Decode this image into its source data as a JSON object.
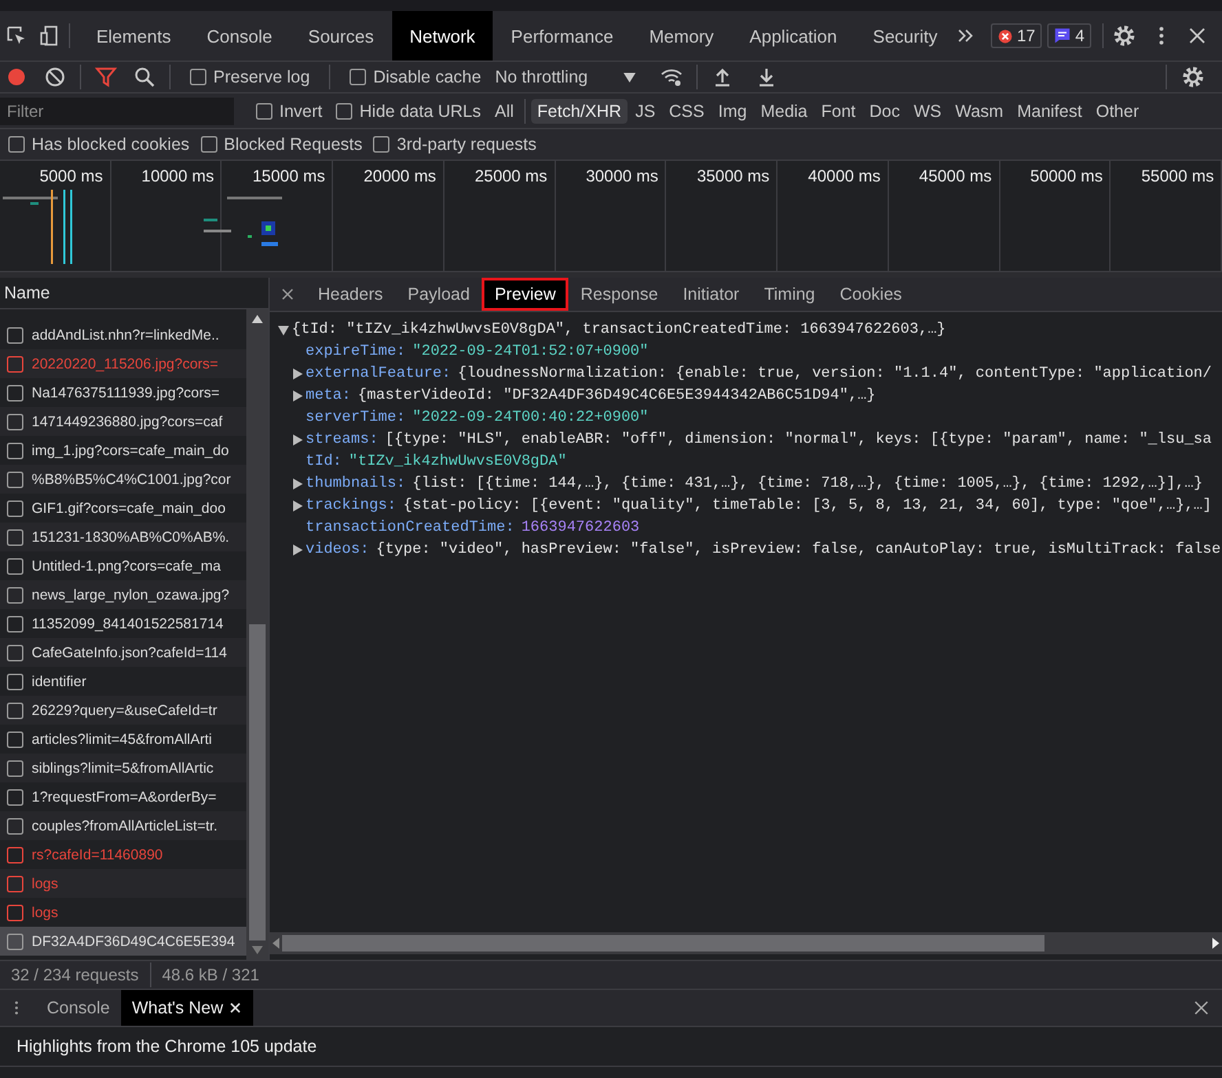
{
  "main_tabs": [
    {
      "label": "Elements",
      "selected": false
    },
    {
      "label": "Console",
      "selected": false
    },
    {
      "label": "Sources",
      "selected": false
    },
    {
      "label": "Network",
      "selected": true
    },
    {
      "label": "Performance",
      "selected": false
    },
    {
      "label": "Memory",
      "selected": false
    },
    {
      "label": "Application",
      "selected": false
    },
    {
      "label": "Security",
      "selected": false
    }
  ],
  "issues": {
    "errors": "17",
    "messages": "4"
  },
  "toolbar": {
    "preserve_log": {
      "label": "Preserve log",
      "checked": false
    },
    "disable_cache": {
      "label": "Disable cache",
      "checked": false
    },
    "throttling": "No throttling"
  },
  "filter": {
    "placeholder": "Filter",
    "options": [
      {
        "label": "Invert",
        "checked": false
      },
      {
        "label": "Hide data URLs",
        "checked": false
      }
    ],
    "types": [
      {
        "label": "All",
        "selected": false
      },
      {
        "label": "Fetch/XHR",
        "selected": true
      },
      {
        "label": "JS",
        "selected": false
      },
      {
        "label": "CSS",
        "selected": false
      },
      {
        "label": "Img",
        "selected": false
      },
      {
        "label": "Media",
        "selected": false
      },
      {
        "label": "Font",
        "selected": false
      },
      {
        "label": "Doc",
        "selected": false
      },
      {
        "label": "WS",
        "selected": false
      },
      {
        "label": "Wasm",
        "selected": false
      },
      {
        "label": "Manifest",
        "selected": false
      },
      {
        "label": "Other",
        "selected": false
      }
    ]
  },
  "blocked_filters": [
    {
      "label": "Has blocked cookies",
      "checked": false
    },
    {
      "label": "Blocked Requests",
      "checked": false
    },
    {
      "label": "3rd-party requests",
      "checked": false
    }
  ],
  "timeline": {
    "ticks": [
      "5000 ms",
      "10000 ms",
      "15000 ms",
      "20000 ms",
      "25000 ms",
      "30000 ms",
      "35000 ms",
      "40000 ms",
      "45000 ms",
      "50000 ms",
      "55000 ms"
    ]
  },
  "requests": {
    "header": "Name",
    "rows": [
      {
        "name": "addAndList.nhn?r=linkedMe..",
        "failed": false,
        "selected": false
      },
      {
        "name": "20220220_115206.jpg?cors=",
        "failed": true,
        "selected": false
      },
      {
        "name": "Na1476375111939.jpg?cors=",
        "failed": false,
        "selected": false
      },
      {
        "name": "1471449236880.jpg?cors=caf",
        "failed": false,
        "selected": false
      },
      {
        "name": "img_1.jpg?cors=cafe_main_do",
        "failed": false,
        "selected": false
      },
      {
        "name": "%B8%B5%C4%C1001.jpg?cor",
        "failed": false,
        "selected": false
      },
      {
        "name": "GIF1.gif?cors=cafe_main_doo",
        "failed": false,
        "selected": false
      },
      {
        "name": "151231-1830%AB%C0%AB%.",
        "failed": false,
        "selected": false
      },
      {
        "name": "Untitled-1.png?cors=cafe_ma",
        "failed": false,
        "selected": false
      },
      {
        "name": "news_large_nylon_ozawa.jpg?",
        "failed": false,
        "selected": false
      },
      {
        "name": "11352099_841401522581714",
        "failed": false,
        "selected": false
      },
      {
        "name": "CafeGateInfo.json?cafeId=114",
        "failed": false,
        "selected": false
      },
      {
        "name": "identifier",
        "failed": false,
        "selected": false
      },
      {
        "name": "26229?query=&useCafeId=tr",
        "failed": false,
        "selected": false
      },
      {
        "name": "articles?limit=45&fromAllArti",
        "failed": false,
        "selected": false
      },
      {
        "name": "siblings?limit=5&fromAllArtic",
        "failed": false,
        "selected": false
      },
      {
        "name": "1?requestFrom=A&orderBy=",
        "failed": false,
        "selected": false
      },
      {
        "name": "couples?fromAllArticleList=tr.",
        "failed": false,
        "selected": false
      },
      {
        "name": "rs?cafeId=11460890",
        "failed": true,
        "selected": false
      },
      {
        "name": "logs",
        "failed": true,
        "selected": false
      },
      {
        "name": "logs",
        "failed": true,
        "selected": false
      },
      {
        "name": "DF32A4DF36D49C4C6E5E394",
        "failed": false,
        "selected": true
      }
    ]
  },
  "detail_tabs": [
    {
      "label": "Headers",
      "selected": false
    },
    {
      "label": "Payload",
      "selected": false
    },
    {
      "label": "Preview",
      "selected": true
    },
    {
      "label": "Response",
      "selected": false
    },
    {
      "label": "Initiator",
      "selected": false
    },
    {
      "label": "Timing",
      "selected": false
    },
    {
      "label": "Cookies",
      "selected": false
    }
  ],
  "preview": {
    "root": {
      "text": "{tId: \"tIZv_ik4zhwUwvsE0V8gDA\", transactionCreatedTime: 1663947622603,…}",
      "expanded": true
    },
    "properties": [
      {
        "key": "expireTime:",
        "value": "\"2022-09-24T01:52:07+0900\"",
        "kind": "string",
        "expandable": false
      },
      {
        "key": "externalFeature:",
        "value": "{loudnessNormalization: {enable: true, version: \"1.1.4\", contentType: \"application/",
        "kind": "object",
        "expandable": true
      },
      {
        "key": "meta:",
        "value": "{masterVideoId: \"DF32A4DF36D49C4C6E5E3944342AB6C51D94\",…}",
        "kind": "object",
        "expandable": true
      },
      {
        "key": "serverTime:",
        "value": "\"2022-09-24T00:40:22+0900\"",
        "kind": "string",
        "expandable": false
      },
      {
        "key": "streams:",
        "value": "[{type: \"HLS\", enableABR: \"off\", dimension: \"normal\", keys: [{type: \"param\", name: \"_lsu_sa",
        "kind": "object",
        "expandable": true
      },
      {
        "key": "tId:",
        "value": "\"tIZv_ik4zhwUwvsE0V8gDA\"",
        "kind": "string",
        "expandable": false
      },
      {
        "key": "thumbnails:",
        "value": "{list: [{time: 144,…}, {time: 431,…}, {time: 718,…}, {time: 1005,…}, {time: 1292,…}],…}",
        "kind": "object",
        "expandable": true
      },
      {
        "key": "trackings:",
        "value": "{stat-policy: [{event: \"quality\", timeTable: [3, 5, 8, 13, 21, 34, 60], type: \"qoe\",…},…]",
        "kind": "object",
        "expandable": true
      },
      {
        "key": "transactionCreatedTime:",
        "value": "1663947622603",
        "kind": "number",
        "expandable": false
      },
      {
        "key": "videos:",
        "value": "{type: \"video\", hasPreview: \"false\", isPreview: false, canAutoPlay: true, isMultiTrack: false",
        "kind": "object",
        "expandable": true
      }
    ]
  },
  "status": {
    "requests": "32 / 234 requests",
    "transferred": "48.6 kB / 321"
  },
  "drawer": {
    "tabs": [
      {
        "label": "Console",
        "selected": false,
        "closable": false
      },
      {
        "label": "What's New",
        "selected": true,
        "closable": true
      }
    ],
    "headline": "Highlights from the Chrome 105 update"
  }
}
